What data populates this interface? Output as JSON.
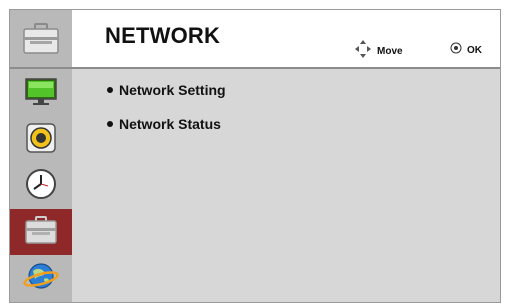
{
  "header": {
    "title": "NETWORK",
    "move_label": "Move",
    "ok_label": "OK",
    "icon": "toolbox-icon"
  },
  "sidebar": {
    "items": [
      {
        "icon": "monitor-icon",
        "active": false
      },
      {
        "icon": "speaker-icon",
        "active": false
      },
      {
        "icon": "clock-icon",
        "active": false
      },
      {
        "icon": "toolbox-icon",
        "active": true
      },
      {
        "icon": "globe-icon",
        "active": false
      }
    ]
  },
  "menu": {
    "items": [
      {
        "label": "Network Setting"
      },
      {
        "label": "Network Status"
      }
    ]
  },
  "colors": {
    "sidebar_bg": "#b9b9b9",
    "content_bg": "#d7d7d7",
    "active_bg": "#8f2929"
  }
}
